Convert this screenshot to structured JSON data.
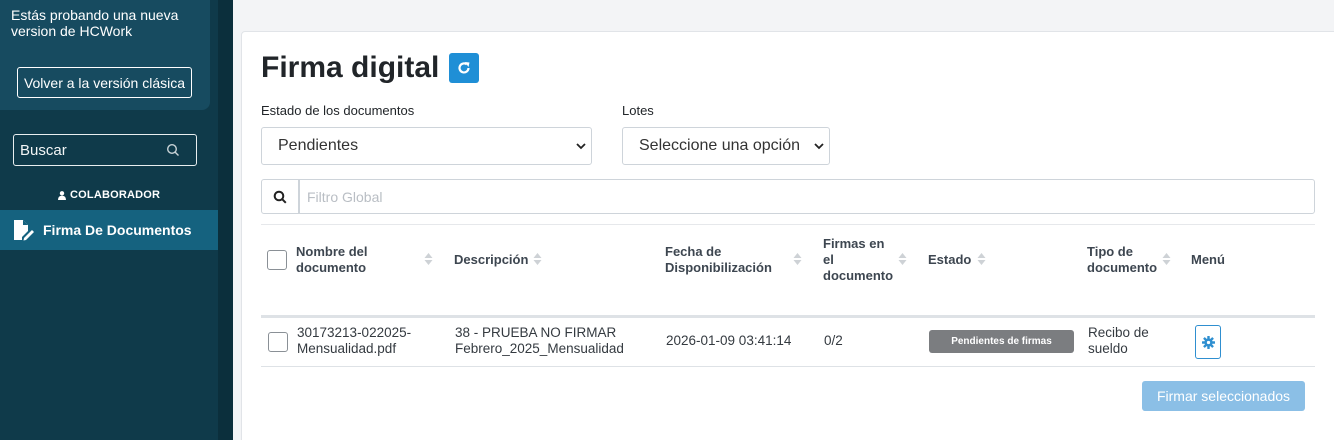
{
  "sidebar": {
    "promo_text": "Estás probando una nueva version de HCWork",
    "classic_button": "Volver a la versión clásica",
    "search_placeholder": "Buscar",
    "role": "COLABORADOR",
    "menu_item": "Firma De Documentos"
  },
  "main": {
    "title": "Firma digital",
    "estado_label": "Estado de los documentos",
    "estado_value": "Pendientes",
    "lotes_label": "Lotes",
    "lotes_value": "Seleccione una opción",
    "filter_placeholder": "Filtro Global"
  },
  "table": {
    "headers": {
      "nombre": [
        "Nombre del",
        "documento"
      ],
      "descripcion": "Descripción",
      "fecha": [
        "Fecha de",
        "Disponibilización"
      ],
      "firmas": [
        "Firmas en",
        "el",
        "documento"
      ],
      "estado": "Estado",
      "tipo": [
        "Tipo de",
        "documento"
      ],
      "menu": "Menú"
    },
    "rows": [
      {
        "nombre": [
          "30173213-022025-",
          "Mensualidad.pdf"
        ],
        "descripcion": [
          "38 - PRUEBA NO FIRMAR",
          "Febrero_2025_Mensualidad"
        ],
        "fecha": "2026-01-09 03:41:14",
        "firmas": "0/2",
        "estado": "Pendientes de firmas",
        "tipo": [
          "Recibo de",
          "sueldo"
        ]
      }
    ]
  },
  "actions": {
    "sign_selected": "Firmar seleccionados"
  },
  "colors": {
    "sidebar_bg": "#0f3a4a",
    "active_menu": "#15627f",
    "primary": "#1f8fd6",
    "badge": "#7b7d80"
  }
}
